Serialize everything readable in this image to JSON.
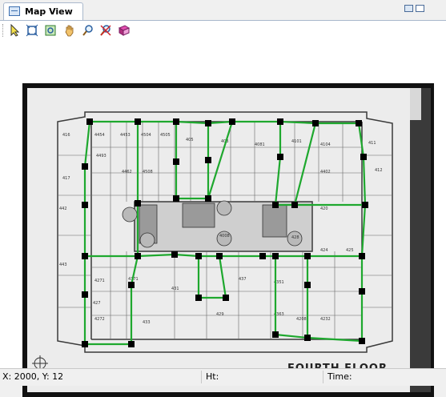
{
  "window": {
    "tab_title": "Map View"
  },
  "toolbar": {
    "tools": [
      {
        "name": "select-tool-icon"
      },
      {
        "name": "fit-extent-tool-icon"
      },
      {
        "name": "zoom-extent-tool-icon"
      },
      {
        "name": "pan-hand-tool-icon"
      },
      {
        "name": "zoom-tool-icon"
      },
      {
        "name": "clear-tool-icon"
      },
      {
        "name": "layers-book-tool-icon"
      }
    ]
  },
  "map": {
    "floor_label": "FOURTH FLOOR",
    "colors": {
      "route": "#1ea82e",
      "node": "#000000",
      "paper": "#e9e9e9",
      "ink": "#333333"
    },
    "room_labels": [
      {
        "text": "416"
      },
      {
        "text": "4454"
      },
      {
        "text": "4453"
      },
      {
        "text": "4504"
      },
      {
        "text": "4505"
      },
      {
        "text": "405"
      },
      {
        "text": "403"
      },
      {
        "text": "4081"
      },
      {
        "text": "4101"
      },
      {
        "text": "4104"
      },
      {
        "text": "411"
      },
      {
        "text": "417"
      },
      {
        "text": "4493"
      },
      {
        "text": "4462"
      },
      {
        "text": "4508"
      },
      {
        "text": "4402"
      },
      {
        "text": "412"
      },
      {
        "text": "442"
      },
      {
        "text": "420"
      },
      {
        "text": "443"
      },
      {
        "text": "424"
      },
      {
        "text": "425"
      },
      {
        "text": "431"
      },
      {
        "text": "437"
      },
      {
        "text": "429"
      },
      {
        "text": "4271"
      },
      {
        "text": "4371"
      },
      {
        "text": "4351"
      },
      {
        "text": "4272"
      },
      {
        "text": "4232"
      },
      {
        "text": "433"
      },
      {
        "text": "427"
      },
      {
        "text": "4363"
      },
      {
        "text": "4208"
      },
      {
        "text": "4008"
      },
      {
        "text": "428"
      }
    ]
  },
  "status": {
    "coords": "X: 2000, Y: 12",
    "ht_label": "Ht:",
    "time_label": "Time:"
  }
}
